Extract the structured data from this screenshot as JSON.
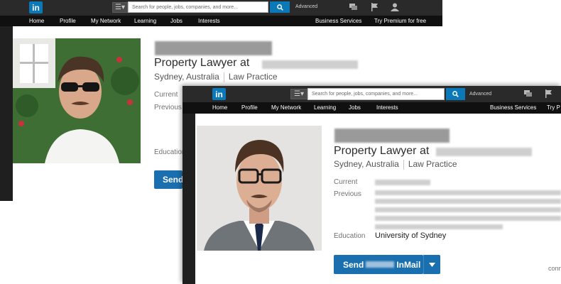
{
  "header": {
    "logo": "in",
    "search_placeholder": "Search for people, jobs, companies, and more...",
    "advanced": "Advanced"
  },
  "nav": {
    "home": "Home",
    "profile": "Profile",
    "network": "My Network",
    "learning": "Learning",
    "jobs": "Jobs",
    "interests": "Interests",
    "business": "Business Services",
    "premium": "Try Premium for free",
    "premium_cut": "Try P"
  },
  "profile": {
    "headline": "Property Lawyer at",
    "location": "Sydney, Australia",
    "industry": "Law Practice",
    "current_label": "Current",
    "previous_label": "Previous",
    "education_label": "Education",
    "education_value": "University of Sydney",
    "send_prefix": "Send",
    "send_suffix": "InMail",
    "connections_fragment": "conn"
  },
  "colors": {
    "brand": "#0b78b7",
    "button": "#1a6fae",
    "topbar": "#2a2a2a",
    "navbar": "#101010"
  }
}
